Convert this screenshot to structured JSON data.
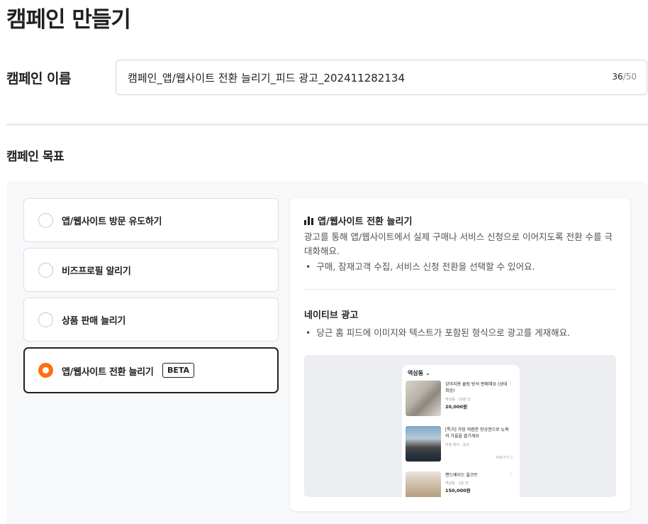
{
  "page": {
    "title": "캠페인 만들기"
  },
  "campaign_name": {
    "label": "캠페인 이름",
    "value": "캠페인_앱/웹사이트 전환 늘리기_피드 광고_202411282134",
    "count": "36",
    "max": "/50"
  },
  "goal": {
    "label": "캠페인 목표",
    "options": [
      {
        "label": "앱/웹사이트 방문 유도하기",
        "selected": false
      },
      {
        "label": "비즈프로필 알리기",
        "selected": false
      },
      {
        "label": "상품 판매 늘리기",
        "selected": false
      },
      {
        "label": "앱/웹사이트 전환 늘리기",
        "selected": true,
        "badge": "BETA"
      }
    ]
  },
  "detail": {
    "title": "앱/웹사이트 전환 늘리기",
    "icon": "bar-chart-icon",
    "description": "광고를 통해 앱/웹사이트에서 실제 구매나 서비스 신청으로 이어지도록 전환 수를 극대화해요.",
    "bullet": "구매, 잠재고객 수집, 서비스 신청 전환을 선택할 수 있어요.",
    "native_title": "네이티브 광고",
    "native_bullet": "당근 홈 피드에 이미지와 텍스트가 포함된 형식으로 광고를 게재해요."
  },
  "preview": {
    "location": "역삼동",
    "items": [
      {
        "title": "강아지용 쿨링 방석 판매해요 (상태 최상)",
        "meta": "역삼동 · 10분 전",
        "price": "20,000원"
      },
      {
        "title": "[특가] 가장 저렴한 항공권으로 뉴욕의 가을을 즐기세요",
        "meta": "여행 에이 · 광고",
        "link": "바로가기 >"
      },
      {
        "title": "핸드메이드 울코트",
        "meta": "역삼동 · 1분 전",
        "price": "150,000원"
      }
    ]
  },
  "colors": {
    "accent": "#ff6f0f",
    "text": "#212124",
    "panel": "#f7f8fa"
  }
}
